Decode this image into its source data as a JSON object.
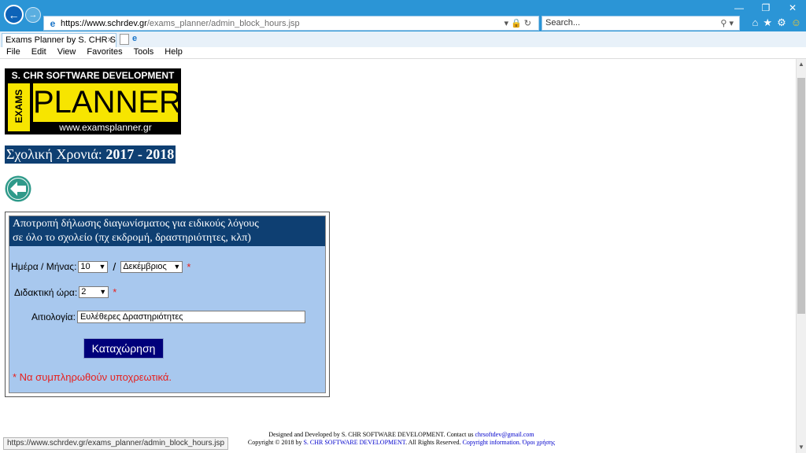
{
  "browser": {
    "url_host": "https://www.schrdev.gr",
    "url_path": "/exams_planner/admin_block_hours.jsp",
    "search_placeholder": "Search...",
    "tab_title": "Exams Planner by S. CHR S...",
    "menu": [
      "File",
      "Edit",
      "View",
      "Favorites",
      "Tools",
      "Help"
    ],
    "status_url": "https://www.schrdev.gr/exams_planner/admin_block_hours.jsp",
    "icons": {
      "back": "back-arrow-icon",
      "forward": "forward-arrow-icon",
      "lock": "lock-icon",
      "refresh": "refresh-icon",
      "search": "search-icon",
      "home": "home-icon",
      "favorites": "star-icon",
      "settings": "gear-icon",
      "feedback": "smiley-icon"
    },
    "chrome_color": "#2b95d6"
  },
  "logo": {
    "company": "S. CHR SOFTWARE DEVELOPMENT",
    "side_text": "EXAMS",
    "main_text": "PLANNER",
    "website": "www.examsplanner.gr",
    "yellow": "#f7e500"
  },
  "school_year": {
    "label": "Σχολική Χρονιά:",
    "value": "2017 - 2018"
  },
  "form": {
    "header_line1": "Αποτροπή δήλωσης διαγωνίσματος για ειδικούς λόγους",
    "header_line2": "σε όλο το σχολείο (πχ εκδρομή, δραστηριότητες, κλπ)",
    "day_month_label": "Ημέρα / Μήνας:",
    "day_value": "10",
    "separator": "/",
    "month_value": "Δεκέμβριος",
    "hour_label": "Διδακτική ώρα:",
    "hour_value": "2",
    "reason_label": "Αιτιολογία:",
    "reason_value": "Ευλέθερες Δραστηριότητες",
    "required_mark": "*",
    "submit_label": "Καταχώρηση",
    "required_note": "* Να συμπληρωθούν υποχρεωτικά.",
    "header_color": "#0e3f72",
    "panel_color": "#a8c8ee",
    "button_color": "#00007a",
    "required_color": "#e8201d"
  },
  "footer": {
    "line1_text": "Designed and Developed by S. CHR SOFTWARE DEVELOPMENT. Contact us",
    "email": "chrsoftdev@gmail.com",
    "line2_prefix": "Copyright © 2018 by",
    "line2_company": "S. CHR SOFTWARE DEVELOPMENT",
    "line2_rights": ". All Rights Reserved.",
    "copyright_link": "Copyright information.",
    "terms_link": "Όροι χρήσης"
  }
}
